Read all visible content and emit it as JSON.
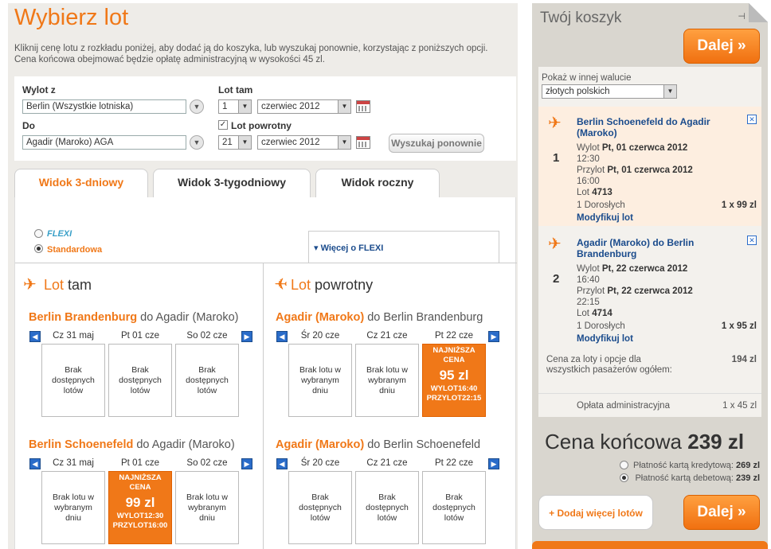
{
  "page": {
    "title": "Wybierz lot",
    "intro_line1": "Kliknij cenę lotu z rozkładu poniżej, aby dodać ją do koszyka, lub wyszukaj ponownie, korzystając z poniższych opcji.",
    "intro_line2": "Cena końcowa obejmować będzie opłatę administracyjną w wysokości 45 zl."
  },
  "search": {
    "from_label": "Wylot z",
    "from_value": "Berlin (Wszystkie lotniska)",
    "to_label": "Do",
    "to_value": "Agadir (Maroko) AGA",
    "out_label": "Lot tam",
    "out_day": "1",
    "out_month": "czerwiec 2012",
    "return_label": "Lot powrotny",
    "return_day": "21",
    "return_month": "czerwiec 2012",
    "search_again": "Wyszukaj ponownie"
  },
  "tabs": [
    "Widok 3-dniowy",
    "Widok 3-tygodniowy",
    "Widok roczny"
  ],
  "fares": {
    "flexi": "FLEXI",
    "standard": "Standardowa",
    "more_flexi": "▾ Więcej o FLEXI"
  },
  "outbound": {
    "title_a": "Lot",
    "title_b": "tam",
    "routes": [
      {
        "from": "Berlin Brandenburg",
        "rest": " do Agadir (Maroko)",
        "days": [
          "Cz 31 maj",
          "Pt 01 cze",
          "So 02 cze"
        ],
        "cells": [
          "Brak dostępnych lotów",
          "Brak dostępnych lotów",
          "Brak dostępnych lotów"
        ]
      },
      {
        "from": "Berlin Schoenefeld",
        "rest": " do Agadir (Maroko)",
        "days": [
          "Cz 31 maj",
          "Pt 01 cze",
          "So 02 cze"
        ],
        "cells": [
          "Brak lotu w wybranym dniu",
          "",
          "Brak lotu w wybranym dniu"
        ],
        "low": {
          "label": "NAJNIŻSZA CENA",
          "price": "99 zl",
          "dep": "WYLOT12:30",
          "arr": "PRZYLOT16:00"
        }
      }
    ]
  },
  "inbound": {
    "title_a": "Lot",
    "title_b": "powrotny",
    "routes": [
      {
        "from": "Agadir (Maroko)",
        "rest": " do Berlin Brandenburg",
        "days": [
          "Śr 20 cze",
          "Cz 21 cze",
          "Pt 22 cze"
        ],
        "cells": [
          "Brak lotu w wybranym dniu",
          "Brak lotu w wybranym dniu",
          ""
        ],
        "low": {
          "label": "NAJNIŻSZA CENA",
          "price": "95 zl",
          "dep": "WYLOT16:40",
          "arr": "PRZYLOT22:15"
        }
      },
      {
        "from": "Agadir (Maroko)",
        "rest": " do Berlin Schoenefeld",
        "days": [
          "Śr 20 cze",
          "Cz 21 cze",
          "Pt 22 cze"
        ],
        "cells": [
          "Brak dostępnych lotów",
          "Brak dostępnych lotów",
          "Brak dostępnych lotów"
        ]
      }
    ]
  },
  "cart": {
    "title": "Twój koszyk",
    "next": "Dalej »",
    "currency_label": "Pokaż w innej walucie",
    "currency_value": "złotych polskich",
    "flights": [
      {
        "num": "1",
        "title": "Berlin Schoenefeld do Agadir (Maroko)",
        "dep_lbl": "Wylot",
        "dep_date": "Pt, 01 czerwca 2012",
        "dep_time": "12:30",
        "arr_lbl": "Przylot",
        "arr_date": "Pt, 01 czerwca 2012",
        "arr_time": "16:00",
        "flight_lbl": "Lot",
        "flight_no": "4713",
        "pax": "1 Dorosłych",
        "price": "1 x 99 zl",
        "modify": "Modyfikuj lot"
      },
      {
        "num": "2",
        "title": "Agadir (Maroko) do Berlin Brandenburg",
        "dep_lbl": "Wylot",
        "dep_date": "Pt, 22 czerwca 2012",
        "dep_time": "16:40",
        "arr_lbl": "Przylot",
        "arr_date": "Pt, 22 czerwca 2012",
        "arr_time": "22:15",
        "flight_lbl": "Lot",
        "flight_no": "4714",
        "pax": "1 Dorosłych",
        "price": "1 x 95 zl",
        "modify": "Modyfikuj lot"
      }
    ],
    "sum_label": "Cena za loty i opcje dla wszystkich pasażerów ogółem:",
    "sum_value": "194 zl",
    "fee_label": "Opłata administracyjna",
    "fee_value": "1 x 45 zl",
    "total_label": "Cena końcowa",
    "total_value": "239 zl",
    "pay_credit": "Płatność kartą kredytową:",
    "pay_credit_val": "269 zl",
    "pay_debit": "Płatność kartą debetową:",
    "pay_debit_val": "239 zl",
    "add_more": "Dodaj więcej lotów"
  },
  "colors": {
    "accent": "#f07818",
    "link": "#1a4b8c"
  }
}
